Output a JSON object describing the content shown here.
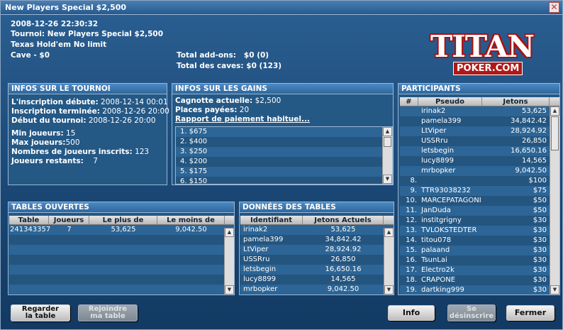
{
  "window": {
    "title": "New Players Special $2,500"
  },
  "summary": {
    "datetime": "2008-12-26 22:30:32",
    "tournament": "Tournoi: New Players Special $2,500",
    "game": "Texas Hold'em No limit",
    "buyin": "Cave - $0",
    "addons": "Total add-ons:   $0 (0)",
    "rebuys": "Total des caves: $0 (123)"
  },
  "logo": {
    "main": "TITAN",
    "sub": "POKER.COM"
  },
  "tourney_info": {
    "header": "INFOS SUR LE TOURNOI",
    "items": [
      {
        "label": "L'inscription débute:",
        "value": "2008-12-14 00:01"
      },
      {
        "label": "Inscription terminée:",
        "value": "2008-12-26 20:00"
      },
      {
        "label": "Début du tournoi:",
        "value": "2008-12-26 20:00"
      },
      {
        "label": "Min joueurs:",
        "value": "15"
      },
      {
        "label": "Max joueurs:",
        "value": "500"
      },
      {
        "label": "Nombres de joueurs inscrits:",
        "value": "123"
      },
      {
        "label": "Joueurs restants:",
        "value": "7"
      }
    ]
  },
  "prize_info": {
    "header": "INFOS SUR LES GAINS",
    "pool_label": "Cagnotte actuelle:",
    "pool_value": "$2,500",
    "paid_label": "Places payées:",
    "paid_value": "20",
    "link": "Rapport de paiement habituel...",
    "payouts": [
      "1. $675",
      "2. $400",
      "3. $250",
      "4. $200",
      "5. $175",
      "6. $150"
    ]
  },
  "participants": {
    "header": "PARTICIPANTS",
    "cols": [
      "#",
      "Pseudo",
      "Jetons"
    ],
    "rows": [
      [
        "",
        "irinak2",
        "53,625"
      ],
      [
        "",
        "pamela399",
        "34,842.42"
      ],
      [
        "",
        "LtViper",
        "28,924.92"
      ],
      [
        "",
        "USSRru",
        "26,850"
      ],
      [
        "",
        "letsbegin",
        "16,650.16"
      ],
      [
        "",
        "lucy8899",
        "14,565"
      ],
      [
        "",
        "mrbopker",
        "9,042.50"
      ],
      [
        "8.",
        "",
        "$100"
      ],
      [
        "9.",
        "TTR93038232",
        "$75"
      ],
      [
        "10.",
        "MARCEPATAGONI",
        "$50"
      ],
      [
        "11.",
        "JanDuda",
        "$50"
      ],
      [
        "12.",
        "institgrigny",
        "$30"
      ],
      [
        "13.",
        "TVLOKSTEDTER",
        "$30"
      ],
      [
        "14.",
        "titou078",
        "$30"
      ],
      [
        "15.",
        "palaand",
        "$30"
      ],
      [
        "16.",
        "TsunLai",
        "$30"
      ],
      [
        "17.",
        "Electro2k",
        "$30"
      ],
      [
        "18.",
        "CRAPONE",
        "$30"
      ],
      [
        "19.",
        "dartking999",
        "$30"
      ]
    ]
  },
  "open_tables": {
    "header": "TABLES OUVERTES",
    "cols": [
      "Table",
      "Joueurs",
      "Le plus de Jetons",
      "Le moins de Jetons"
    ],
    "rows": [
      [
        "241343357",
        "7",
        "53,625",
        "9,042.50"
      ]
    ]
  },
  "table_data": {
    "header": "DONNÉES DES TABLES",
    "cols": [
      "Identifiant",
      "Jetons Actuels"
    ],
    "rows": [
      [
        "irinak2",
        "53,625"
      ],
      [
        "pamela399",
        "34,842.42"
      ],
      [
        "LtViper",
        "28,924.92"
      ],
      [
        "USSRru",
        "26,850"
      ],
      [
        "letsbegin",
        "16,650.16"
      ],
      [
        "lucy8899",
        "14,565"
      ],
      [
        "mrbopker",
        "9,042.50"
      ]
    ]
  },
  "buttons": {
    "watch_l1": "Regarder",
    "watch_l2": "la table",
    "join_l1": "Rejoindre",
    "join_l2": "ma table",
    "info": "Info",
    "unreg_l1": "Se",
    "unreg_l2": "désinscrire",
    "close": "Fermer"
  }
}
